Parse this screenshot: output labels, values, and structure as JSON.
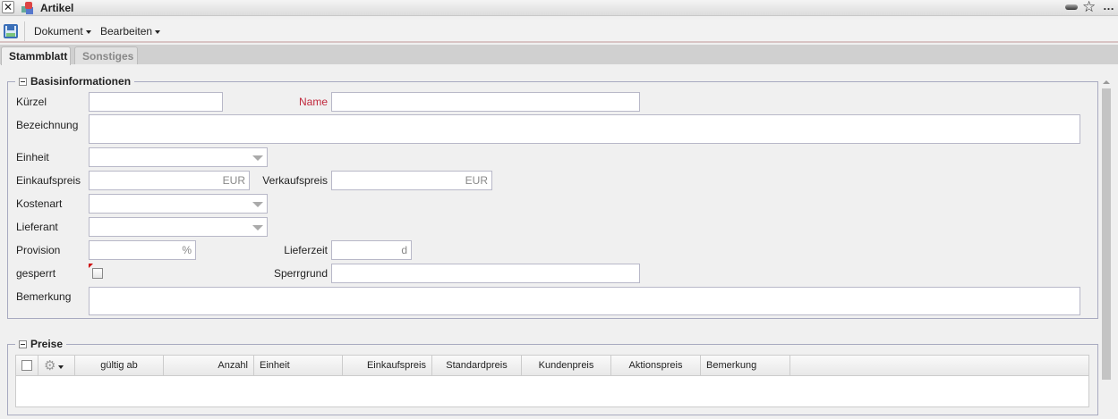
{
  "window": {
    "title": "Artikel"
  },
  "toolbar": {
    "menus": [
      "Dokument",
      "Bearbeiten"
    ]
  },
  "tabs": [
    {
      "label": "Stammblatt",
      "active": true
    },
    {
      "label": "Sonstiges",
      "active": false
    }
  ],
  "basis": {
    "legend": "Basisinformationen",
    "kuerzel": {
      "label": "Kürzel",
      "value": ""
    },
    "name": {
      "label": "Name",
      "value": "",
      "color": "#c0283c"
    },
    "bezeichnung": {
      "label": "Bezeichnung",
      "value": ""
    },
    "einheit": {
      "label": "Einheit",
      "value": ""
    },
    "einkaufspreis": {
      "label": "Einkaufspreis",
      "unit": "EUR"
    },
    "verkaufspreis": {
      "label": "Verkaufspreis",
      "unit": "EUR"
    },
    "kostenart": {
      "label": "Kostenart"
    },
    "lieferant": {
      "label": "Lieferant"
    },
    "provision": {
      "label": "Provision",
      "unit": "%"
    },
    "lieferzeit": {
      "label": "Lieferzeit",
      "unit": "d"
    },
    "gesperrt": {
      "label": "gesperrt",
      "checked": false
    },
    "sperrgrund": {
      "label": "Sperrgrund"
    },
    "bemerkung": {
      "label": "Bemerkung"
    }
  },
  "preise": {
    "legend": "Preise",
    "columns": [
      "gültig ab",
      "Anzahl",
      "Einheit",
      "Einkaufspreis",
      "Standardpreis",
      "Kundenpreis",
      "Aktionspreis",
      "Bemerkung"
    ]
  }
}
